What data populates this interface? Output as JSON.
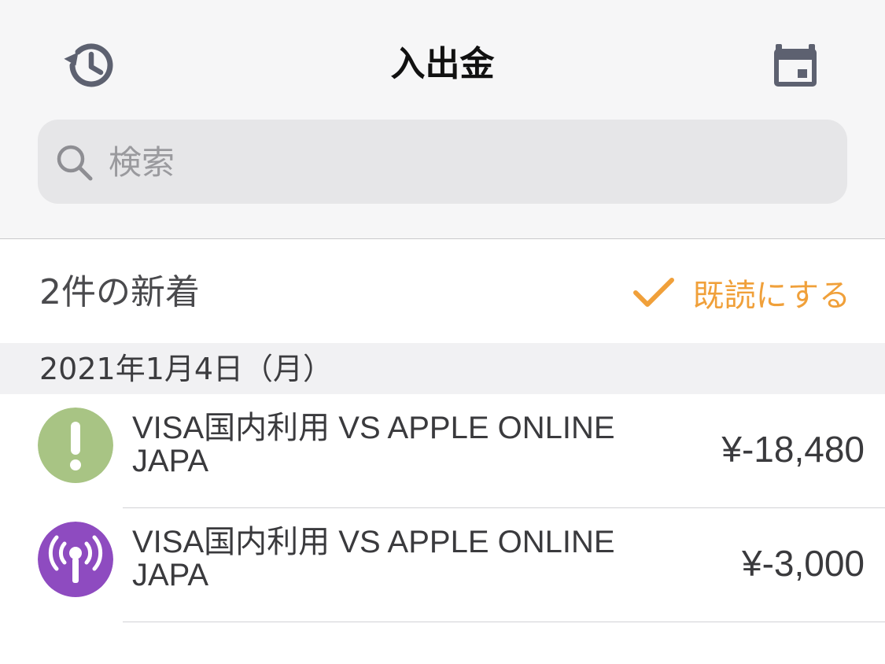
{
  "header": {
    "title": "入出金",
    "left_icon": "history-icon",
    "right_icon": "calendar-icon"
  },
  "search": {
    "placeholder": "検索",
    "value": ""
  },
  "notifications": {
    "new_count_label": "2件の新着",
    "mark_read_label": "既読にする",
    "accent_color": "#f0a03a"
  },
  "section": {
    "date": "2021年1月4日（月）"
  },
  "transactions": [
    {
      "description": "VISA国内利用 VS APPLE ONLINE JAPA",
      "amount": "¥-18,480",
      "icon": "exclamation-icon",
      "icon_color": "#a8c484"
    },
    {
      "description": "VISA国内利用 VS APPLE ONLINE JAPA",
      "amount": "¥-3,000",
      "icon": "broadcast-icon",
      "icon_color": "#8e4bc0"
    }
  ]
}
